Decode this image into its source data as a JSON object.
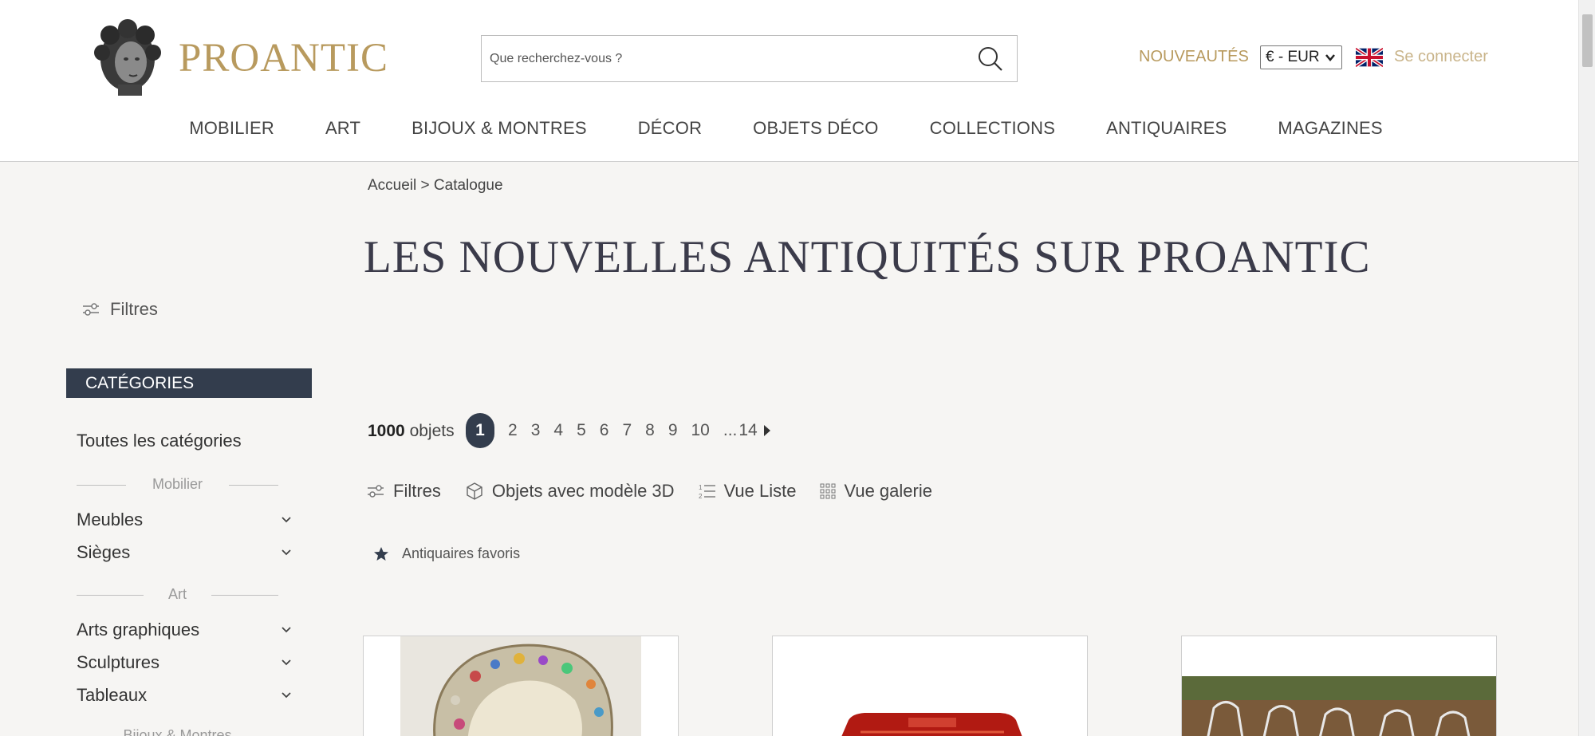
{
  "header": {
    "logo_text": "PROANTIC",
    "search_placeholder": "Que recherchez-vous ?",
    "nouveautes": "NOUVEAUTÉS",
    "currency": "€ - EUR",
    "login": "Se connecter"
  },
  "nav": [
    "MOBILIER",
    "ART",
    "BIJOUX & MONTRES",
    "DÉCOR",
    "OBJETS DÉCO",
    "COLLECTIONS",
    "ANTIQUAIRES",
    "MAGAZINES"
  ],
  "breadcrumb": {
    "home": "Accueil",
    "sep": ">",
    "current": "Catalogue"
  },
  "page_title": "LES NOUVELLES ANTIQUITÉS SUR PROANTIC",
  "sidebar": {
    "filters_label": "Filtres",
    "categories_heading": "CATÉGORIES",
    "all_categories": "Toutes les catégories",
    "groups": [
      {
        "label": "Mobilier",
        "items": [
          "Meubles",
          "Sièges"
        ]
      },
      {
        "label": "Art",
        "items": [
          "Arts graphiques",
          "Sculptures",
          "Tableaux"
        ]
      },
      {
        "label": "Bijoux & Montres",
        "items": []
      }
    ]
  },
  "results": {
    "count": "1000",
    "count_suffix": "objets",
    "pages": [
      "1",
      "2",
      "3",
      "4",
      "5",
      "6",
      "7",
      "8",
      "9",
      "10"
    ],
    "current_page": "1",
    "ellipsis": "...",
    "last_page": "14"
  },
  "toolbar": {
    "filters": "Filtres",
    "model3d": "Objets avec modèle 3D",
    "list_view": "Vue Liste",
    "gallery_view": "Vue galerie",
    "favorites": "Antiquaires favoris"
  },
  "colors": {
    "gold": "#b89a5e",
    "navy": "#333d4d",
    "background": "#f6f5f3"
  }
}
